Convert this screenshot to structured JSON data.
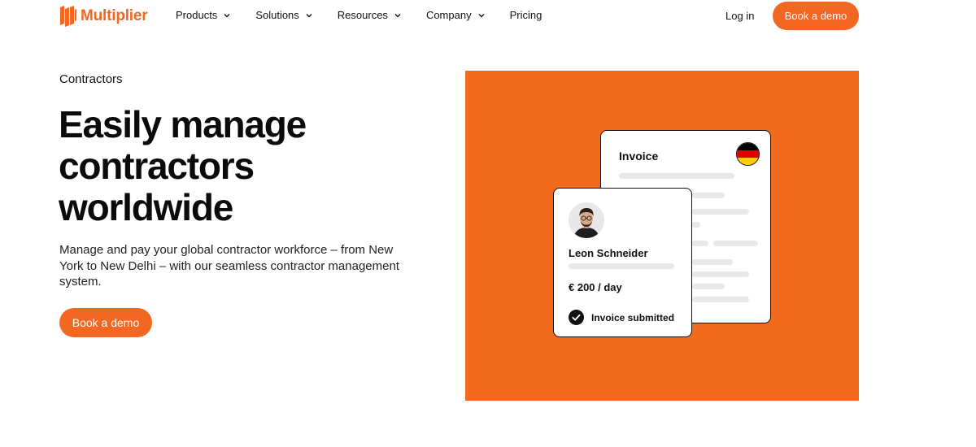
{
  "brand": {
    "name": "Multiplier",
    "color": "#f26722"
  },
  "nav": {
    "items": [
      {
        "label": "Products",
        "has_dropdown": true
      },
      {
        "label": "Solutions",
        "has_dropdown": true
      },
      {
        "label": "Resources",
        "has_dropdown": true
      },
      {
        "label": "Company",
        "has_dropdown": true
      },
      {
        "label": "Pricing",
        "has_dropdown": false
      }
    ],
    "login_label": "Log in",
    "cta_label": "Book a demo"
  },
  "hero": {
    "eyebrow": "Contractors",
    "headline_lines": [
      "Easily manage",
      "contractors",
      "worldwide"
    ],
    "subtext": "Manage and pay your global contractor workforce – from New York to New Delhi – with our seamless contractor management system.",
    "cta_label": "Book a demo"
  },
  "illustration": {
    "panel_color": "#f26a1b",
    "invoice": {
      "title": "Invoice",
      "flag_icon": "germany-flag-icon",
      "flag_colors": [
        "#000000",
        "#dd0000",
        "#ffce00"
      ]
    },
    "contractor": {
      "name": "Leon Schneider",
      "rate": "€ 200 / day",
      "status": "Invoice submitted",
      "status_icon": "check-circle-icon"
    }
  }
}
